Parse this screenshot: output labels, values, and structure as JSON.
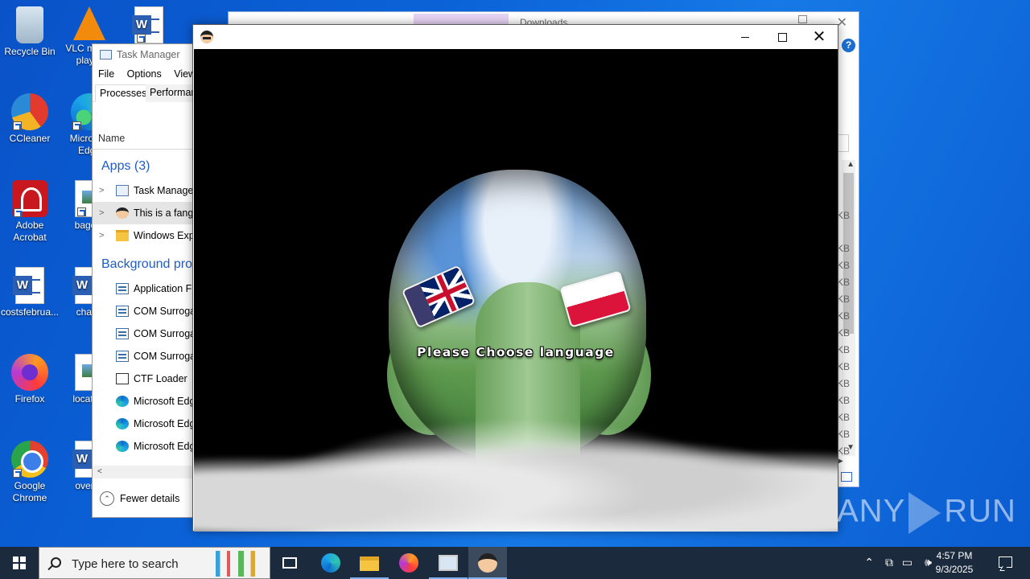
{
  "desktop": {
    "icons": [
      {
        "label": "Recycle Bin",
        "icon": "recycle-bin-icon"
      },
      {
        "label": "VLC media player",
        "icon": "vlc-icon"
      },
      {
        "label": "CCleaner",
        "icon": "ccleaner-icon"
      },
      {
        "label": "Microsoft Edge",
        "icon": "edge-icon"
      },
      {
        "label": "Adobe Acrobat",
        "icon": "acrobat-icon"
      },
      {
        "label": "bagoth",
        "icon": "image-file-icon"
      },
      {
        "label": "costsfebrua...",
        "icon": "word-doc-icon"
      },
      {
        "label": "chang",
        "icon": "word-doc-icon"
      },
      {
        "label": "Firefox",
        "icon": "firefox-icon"
      },
      {
        "label": "location",
        "icon": "image-file-icon"
      },
      {
        "label": "Google Chrome",
        "icon": "chrome-icon"
      },
      {
        "label": "overall",
        "icon": "word-doc-icon"
      },
      {
        "label": "",
        "icon": "word-doc-icon"
      }
    ]
  },
  "explorer": {
    "title": "Downloads",
    "help_label": "?",
    "size_unit_cells": [
      "KB",
      "KB",
      "KB",
      "KB",
      "KB",
      "KB",
      "KB",
      "KB",
      "KB",
      "KB",
      "KB",
      "KB",
      "KB",
      "KB"
    ]
  },
  "task_manager": {
    "title": "Task Manager",
    "menu": [
      "File",
      "Options",
      "View"
    ],
    "tabs": [
      "Processes",
      "Performance"
    ],
    "column_name": "Name",
    "apps_group": "Apps (3)",
    "apps": [
      {
        "label": "Task Manager",
        "icon": "task-manager-icon"
      },
      {
        "label": "This is a fangame",
        "icon": "mario-icon"
      },
      {
        "label": "Windows Explorer",
        "icon": "folder-icon"
      }
    ],
    "background_group": "Background processes",
    "background": [
      {
        "label": "Application Frame Host",
        "icon": "app-window-icon"
      },
      {
        "label": "COM Surrogate",
        "icon": "app-window-icon"
      },
      {
        "label": "COM Surrogate",
        "icon": "app-window-icon"
      },
      {
        "label": "COM Surrogate",
        "icon": "app-window-icon"
      },
      {
        "label": "CTF Loader",
        "icon": "ctf-loader-icon"
      },
      {
        "label": "Microsoft Edge",
        "icon": "edge-icon"
      },
      {
        "label": "Microsoft Edge",
        "icon": "edge-icon"
      },
      {
        "label": "Microsoft Edge",
        "icon": "edge-icon"
      }
    ],
    "fewer_details": "Fewer details"
  },
  "game": {
    "prompt": "Please Choose language",
    "languages": [
      {
        "code": "en",
        "flag": "us-uk-flag"
      },
      {
        "code": "pl",
        "flag": "poland-flag"
      }
    ]
  },
  "watermark": {
    "left": "ANY",
    "right": "RUN"
  },
  "taskbar": {
    "search_placeholder": "Type here to search",
    "pinned": [
      "task-view-icon",
      "edge-icon",
      "file-explorer-icon",
      "firefox-icon",
      "task-manager-icon",
      "mario-game-icon"
    ],
    "clock_time": "4:57 PM",
    "clock_date": "9/3/2025"
  }
}
